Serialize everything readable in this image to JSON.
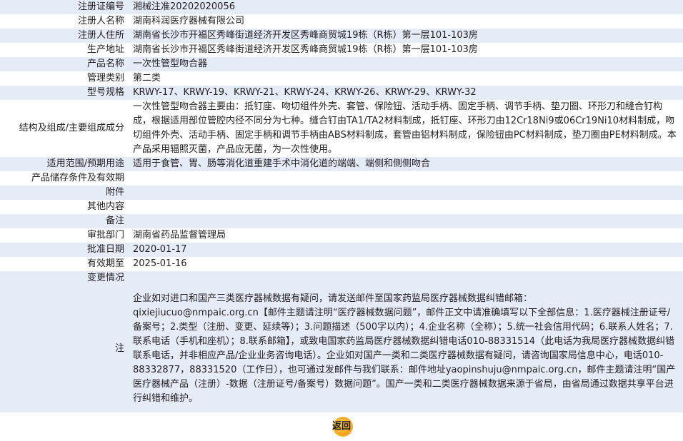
{
  "rows": [
    {
      "label": "注册证编号",
      "value": "湘械注准20202020056"
    },
    {
      "label": "注册人名称",
      "value": "湖南科润医疗器械有限公司"
    },
    {
      "label": "注册人住所",
      "value": "湖南省长沙市开福区秀峰街道经济开发区秀峰商贸城19栋（R栋）第一层101-103房"
    },
    {
      "label": "生产地址",
      "value": "湖南省长沙市开福区秀峰街道经济开发区秀峰商贸城19栋（R栋）第一层101-103房"
    },
    {
      "label": "产品名称",
      "value": "一次性管型吻合器"
    },
    {
      "label": "管理类别",
      "value": "第二类"
    },
    {
      "label": "型号规格",
      "value": "KRWY-17、KRWY-19、KRWY-21、KRWY-24、KRWY-26、KRWY-29、KRWY-32"
    },
    {
      "label": "结构及组成/主要组成成分",
      "value": "一次性管型吻合器主要由：抵钉座、吻切组件外壳、套管、保险钮、活动手柄、固定手柄、调节手柄、垫刀圈、环形刀和缝合钉构成，根据适用部位管腔内径不同分为七种。缝合钉由TA1/TA2材料制成，抵钉座、环形刀由12Cr18Ni9或06Cr19Ni10材料制成，吻切组件外壳、活动手柄、固定手柄和调节手柄由ABS材料制成，套管由铝材料制成，保险钮由PC材料制成，垫刀圈由PE材料制成。本产品采用辐照灭菌，产品应无菌，为一次性使用。"
    },
    {
      "label": "适用范围/预期用途",
      "value": "适用于食管、胃、肠等消化道重建手术中消化道的端端、端侧和侧侧吻合"
    },
    {
      "label": "产品储存条件及有效期",
      "value": ""
    },
    {
      "label": "附件",
      "value": ""
    },
    {
      "label": "其他内容",
      "value": ""
    },
    {
      "label": "备注",
      "value": ""
    },
    {
      "label": "审批部门",
      "value": "湖南省药品监督管理局"
    },
    {
      "label": "批准日期",
      "value": "2020-01-17"
    },
    {
      "label": "有效期至",
      "value": "2025-01-16"
    },
    {
      "label": "变更情况",
      "value": ""
    }
  ],
  "note": {
    "label": "注",
    "p1": "企业如对进口和国产三类医疗器械数据有疑问，请发送邮件至国家药监局医疗器械数据纠错邮箱：",
    "email1": "qixiejiucuo@nmpaic.org.cn",
    "p2": "【邮件主题请注明“医疗器械数据问题”，邮件正文中请准确填写以下全部信息：1.医疗器械注册证号/备案号；2.类型（注册、变更、延续等）；3.问题描述（500字以内）；4.企业名称（全称）；5.统一社会信用代码；6.联系人姓名；7.联系电话（手机和座机）；8.联系邮箱】，或致电国家药监局医疗器械数据纠错电话010-88331514（此电话为我局医疗器械数据纠错联系电话，并非相应产品/企业业务咨询电话）。企业如对国产一类和二类医疗器械数据有疑问，请咨询国家局信息中心，电话010-88332877，88331520（工作日），也可通过发邮件与我们联系：邮件地址",
    "email2": "yaopinshuju@nmpaic.org.cn",
    "p3": "，邮件主题请注明“国产医疗器械产品（注册）-数据（注册证号/备案号）数据问题”。国产一类和二类医疗器械数据来源于省局，由省局通过数据共享平台进行纠错和维护。"
  },
  "back_button": {
    "label": "返回"
  }
}
